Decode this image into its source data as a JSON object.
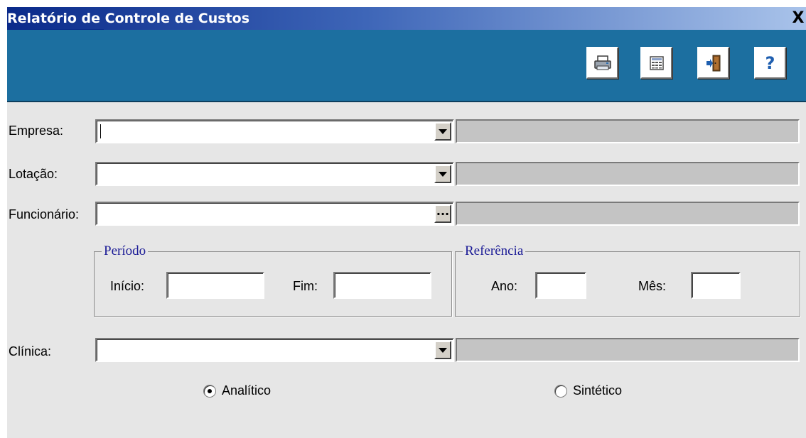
{
  "window": {
    "title": "Relatório de Controle de Custos",
    "close_label": "X"
  },
  "toolbar": {
    "buttons": [
      {
        "icon": "printer-icon"
      },
      {
        "icon": "calculator-icon"
      },
      {
        "icon": "exit-door-icon"
      },
      {
        "icon": "help-question-icon",
        "glyph": "?"
      }
    ]
  },
  "form": {
    "empresa": {
      "label": "Empresa:",
      "value": "",
      "description": ""
    },
    "lotacao": {
      "label": "Lotação:",
      "value": "",
      "description": ""
    },
    "funcionario": {
      "label": "Funcionário:",
      "value": "",
      "description": "",
      "browse_label": "..."
    },
    "periodo": {
      "title": "Período",
      "inicio_label": "Início:",
      "inicio_value": "",
      "fim_label": "Fim:",
      "fim_value": ""
    },
    "referencia": {
      "title": "Referência",
      "ano_label": "Ano:",
      "ano_value": "",
      "mes_label": "Mês:",
      "mes_value": ""
    },
    "clinica": {
      "label": "Clínica:",
      "value": "",
      "description": ""
    },
    "report_type": {
      "options": [
        {
          "label": "Analítico",
          "selected": true
        },
        {
          "label": "Sintético",
          "selected": false
        }
      ]
    }
  }
}
